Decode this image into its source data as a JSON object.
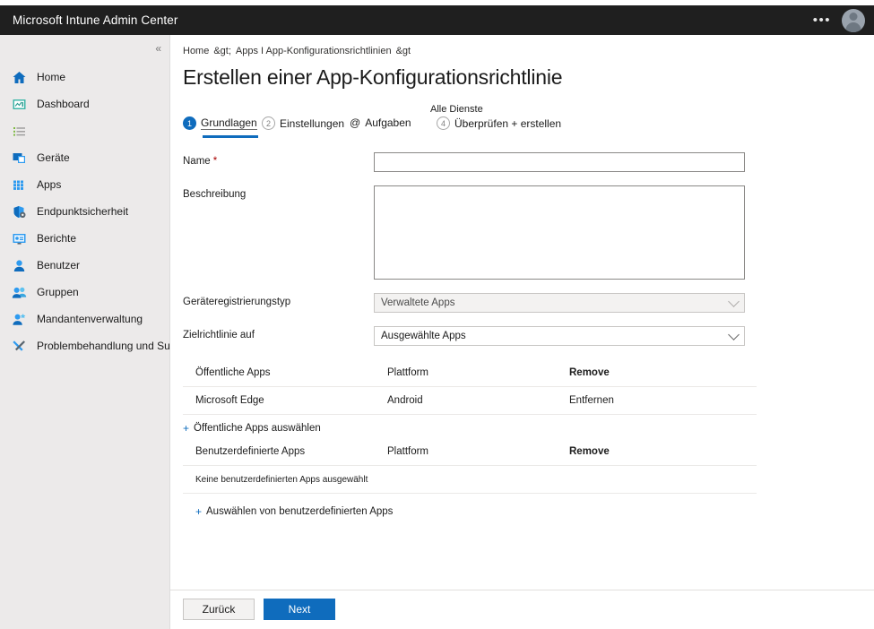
{
  "header": {
    "title": "Microsoft Intune Admin Center",
    "ellipsis": "•••",
    "avatar_icon": "user-avatar-icon"
  },
  "sidebar": {
    "collapse_glyph": "«",
    "items": [
      {
        "label": "Home",
        "icon": "home-icon"
      },
      {
        "label": "Dashboard",
        "icon": "dashboard-icon"
      },
      {
        "label": "",
        "icon": "all-services-list-icon"
      },
      {
        "label": "Geräte",
        "icon": "devices-icon"
      },
      {
        "label": "Apps",
        "icon": "apps-grid-icon"
      },
      {
        "label": "Endpunktsicherheit",
        "icon": "endpoint-security-shield-icon"
      },
      {
        "label": "Berichte",
        "icon": "reports-monitor-icon"
      },
      {
        "label": "Benutzer",
        "icon": "users-person-icon"
      },
      {
        "label": "Gruppen",
        "icon": "groups-people-icon"
      },
      {
        "label": "Mandantenverwaltung",
        "icon": "tenant-administration-icon"
      },
      {
        "label": "Problembehandlung und Support",
        "icon": "troubleshooting-support-icon"
      }
    ]
  },
  "breadcrumb": {
    "home": "Home",
    "sep1": "&gt;",
    "middle": "Apps I App-Konfigurationsrichtlinien",
    "sep2": "&gt"
  },
  "page": {
    "title": "Erstellen einer App-Konfigurationsrichtlinie"
  },
  "steps": {
    "all_services_label": "Alle Dienste",
    "items": [
      {
        "num": "1",
        "label": "Grundlagen",
        "state": "active"
      },
      {
        "num": "2",
        "label": "Einstellungen",
        "state": "inactive"
      },
      {
        "num": "@",
        "label": "Aufgaben",
        "state": "inactive"
      },
      {
        "num": "4",
        "label": "Überprüfen + erstellen",
        "state": "inactive"
      }
    ]
  },
  "form": {
    "name": {
      "label": "Name",
      "required": "*",
      "value": "",
      "placeholder": ""
    },
    "description": {
      "label": "Beschreibung",
      "value": "",
      "placeholder": ""
    },
    "enrollment_type": {
      "label": "Geräteregistrierungstyp",
      "value": "Verwaltete Apps",
      "disabled": true
    },
    "target_policy": {
      "label": "Zielrichtlinie auf",
      "value": "Ausgewählte Apps",
      "disabled": false
    }
  },
  "public_apps": {
    "headers": {
      "name": "Öffentliche Apps",
      "platform": "Plattform",
      "remove": "Remove"
    },
    "rows": [
      {
        "name": "Microsoft Edge",
        "platform": "Android",
        "remove": "Entfernen"
      }
    ],
    "add_link": "Öffentliche Apps auswählen"
  },
  "custom_apps": {
    "headers": {
      "name": "Benutzerdefinierte Apps",
      "platform": "Plattform",
      "remove": "Remove"
    },
    "empty_text": "Keine benutzerdefinierten Apps ausgewählt",
    "add_link": "Auswählen von benutzerdefinierten Apps"
  },
  "footer": {
    "back": "Zurück",
    "next": "Next"
  },
  "colors": {
    "accent": "#0f6cbd",
    "header_bg": "#1f1f1f",
    "sidebar_bg": "#eceaea",
    "required": "#a80000"
  }
}
